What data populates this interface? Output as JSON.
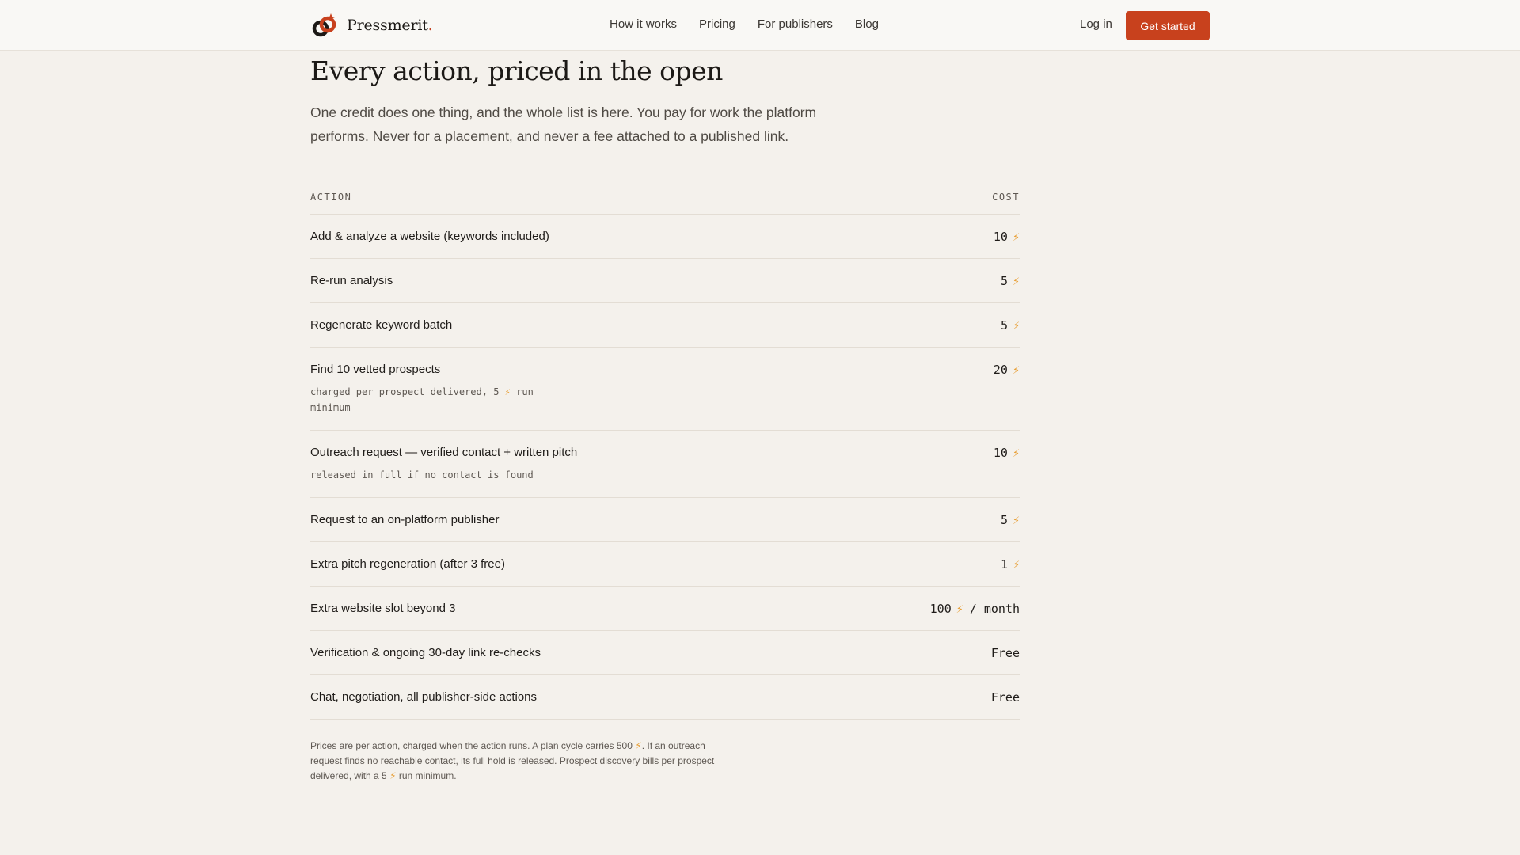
{
  "header": {
    "brand_name": "Pressmerit",
    "brand_dot": ".",
    "nav": [
      "How it works",
      "Pricing",
      "For publishers",
      "Blog"
    ],
    "login": "Log in",
    "cta": "Get started"
  },
  "hero": {
    "title": "Every action, priced in the open",
    "lede": "One credit does one thing, and the whole list is here. You pay for work the platform performs. Never for a placement, and never a fee attached to a published link."
  },
  "table": {
    "col_action": "ACTION",
    "col_cost": "COST",
    "rows": [
      {
        "action": "Add & analyze a website (keywords included)",
        "cost": "10",
        "bolt": "⚡"
      },
      {
        "action": "Re-run analysis",
        "cost": "5",
        "bolt": "⚡"
      },
      {
        "action": "Regenerate keyword batch",
        "cost": "5",
        "bolt": "⚡"
      },
      {
        "action": "Find 10 vetted prospects",
        "cost": "20",
        "bolt": "⚡",
        "note_a": "charged per prospect delivered, 5",
        "note_bolt": "⚡",
        "note_b": "run minimum"
      },
      {
        "action": "Outreach request — verified contact + written pitch",
        "cost": "10",
        "bolt": "⚡",
        "note": "released in full if no contact is found"
      },
      {
        "action": "Request to an on-platform publisher",
        "cost": "5",
        "bolt": "⚡"
      },
      {
        "action": "Extra pitch regeneration (after 3 free)",
        "cost": "1",
        "bolt": "⚡"
      },
      {
        "action": "Extra website slot beyond 3",
        "cost": "100",
        "bolt": "⚡",
        "per": "/ month"
      },
      {
        "action": "Verification & ongoing 30-day link re-checks",
        "cost": "Free"
      },
      {
        "action": "Chat, negotiation, all publisher-side actions",
        "cost": "Free"
      }
    ]
  },
  "footnote": {
    "part1": "Prices are per action, charged when the action runs. A plan cycle carries 500",
    "bolt": "⚡",
    "part2": ". If an outreach request finds no reachable contact, its full hold is released. Prospect discovery bills per prospect delivered, with a 5",
    "part3": "run minimum."
  },
  "colors": {
    "accent": "#c8411d",
    "bolt": "#e8a13a",
    "background": "#f4f1ec"
  }
}
